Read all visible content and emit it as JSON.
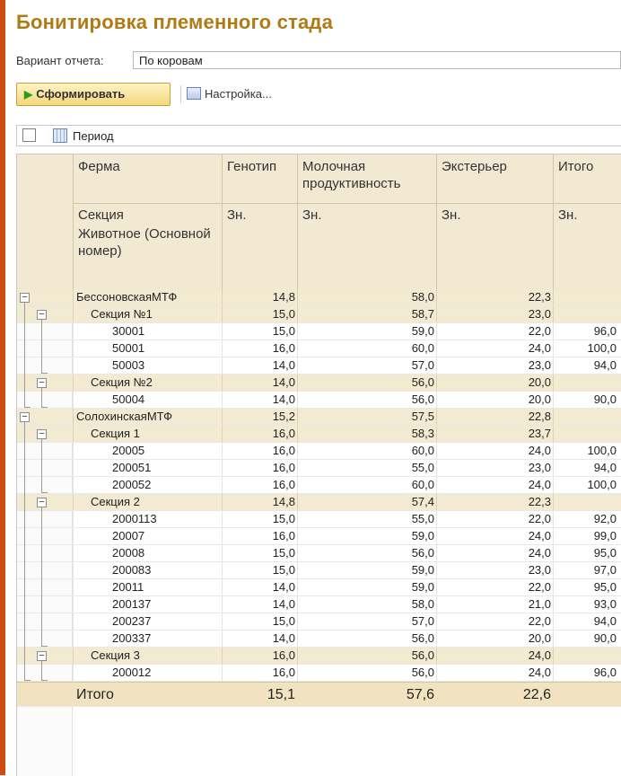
{
  "title": "Бонитировка племенного стада",
  "variant": {
    "label": "Вариант отчета:",
    "value": "По коровам"
  },
  "toolbar": {
    "generate_label": "Сформировать",
    "settings_label": "Настройка..."
  },
  "filter": {
    "period_label": "Период"
  },
  "table": {
    "headers": {
      "farm": "Ферма",
      "genotype": "Генотип",
      "milk": "Молочная продуктивность",
      "exterior": "Экстерьер",
      "total": "Итого",
      "section": "Секция",
      "animal": "Животное (Основной номер)",
      "zn": "Зн."
    },
    "rows": [
      {
        "level": 0,
        "name": "БессоновскаяМТФ",
        "gen": "14,8",
        "milk": "58,0",
        "ext": "22,3",
        "tot": ""
      },
      {
        "level": 1,
        "name": "Секция №1",
        "gen": "15,0",
        "milk": "58,7",
        "ext": "23,0",
        "tot": ""
      },
      {
        "level": 2,
        "name": "30001",
        "gen": "15,0",
        "milk": "59,0",
        "ext": "22,0",
        "tot": "96,0"
      },
      {
        "level": 2,
        "name": "50001",
        "gen": "16,0",
        "milk": "60,0",
        "ext": "24,0",
        "tot": "100,0"
      },
      {
        "level": 2,
        "name": "50003",
        "gen": "14,0",
        "milk": "57,0",
        "ext": "23,0",
        "tot": "94,0"
      },
      {
        "level": 1,
        "name": "Секция №2",
        "gen": "14,0",
        "milk": "56,0",
        "ext": "20,0",
        "tot": ""
      },
      {
        "level": 2,
        "name": "50004",
        "gen": "14,0",
        "milk": "56,0",
        "ext": "20,0",
        "tot": "90,0"
      },
      {
        "level": 0,
        "name": "СолохинскаяМТФ",
        "gen": "15,2",
        "milk": "57,5",
        "ext": "22,8",
        "tot": ""
      },
      {
        "level": 1,
        "name": "Секция 1",
        "gen": "16,0",
        "milk": "58,3",
        "ext": "23,7",
        "tot": ""
      },
      {
        "level": 2,
        "name": "20005",
        "gen": "16,0",
        "milk": "60,0",
        "ext": "24,0",
        "tot": "100,0"
      },
      {
        "level": 2,
        "name": "200051",
        "gen": "16,0",
        "milk": "55,0",
        "ext": "23,0",
        "tot": "94,0"
      },
      {
        "level": 2,
        "name": "200052",
        "gen": "16,0",
        "milk": "60,0",
        "ext": "24,0",
        "tot": "100,0"
      },
      {
        "level": 1,
        "name": "Секция 2",
        "gen": "14,8",
        "milk": "57,4",
        "ext": "22,3",
        "tot": ""
      },
      {
        "level": 2,
        "name": "2000113",
        "gen": "15,0",
        "milk": "55,0",
        "ext": "22,0",
        "tot": "92,0"
      },
      {
        "level": 2,
        "name": "20007",
        "gen": "16,0",
        "milk": "59,0",
        "ext": "24,0",
        "tot": "99,0"
      },
      {
        "level": 2,
        "name": "20008",
        "gen": "15,0",
        "milk": "56,0",
        "ext": "24,0",
        "tot": "95,0"
      },
      {
        "level": 2,
        "name": "200083",
        "gen": "15,0",
        "milk": "59,0",
        "ext": "23,0",
        "tot": "97,0"
      },
      {
        "level": 2,
        "name": "20011",
        "gen": "14,0",
        "milk": "59,0",
        "ext": "22,0",
        "tot": "95,0"
      },
      {
        "level": 2,
        "name": "200137",
        "gen": "14,0",
        "milk": "58,0",
        "ext": "21,0",
        "tot": "93,0"
      },
      {
        "level": 2,
        "name": "200237",
        "gen": "15,0",
        "milk": "57,0",
        "ext": "22,0",
        "tot": "94,0"
      },
      {
        "level": 2,
        "name": "200337",
        "gen": "14,0",
        "milk": "56,0",
        "ext": "20,0",
        "tot": "90,0"
      },
      {
        "level": 1,
        "name": "Секция 3",
        "gen": "16,0",
        "milk": "56,0",
        "ext": "24,0",
        "tot": ""
      },
      {
        "level": 2,
        "name": "200012",
        "gen": "16,0",
        "milk": "56,0",
        "ext": "24,0",
        "tot": "96,0"
      }
    ],
    "totals": {
      "label": "Итого",
      "gen": "15,1",
      "milk": "57,6",
      "ext": "22,6",
      "tot": ""
    }
  },
  "colors": {
    "title": "#b07a16",
    "accent": "#cf4a15",
    "header_bg": "#f2e9d3",
    "group_bg": "#f3ead2"
  }
}
